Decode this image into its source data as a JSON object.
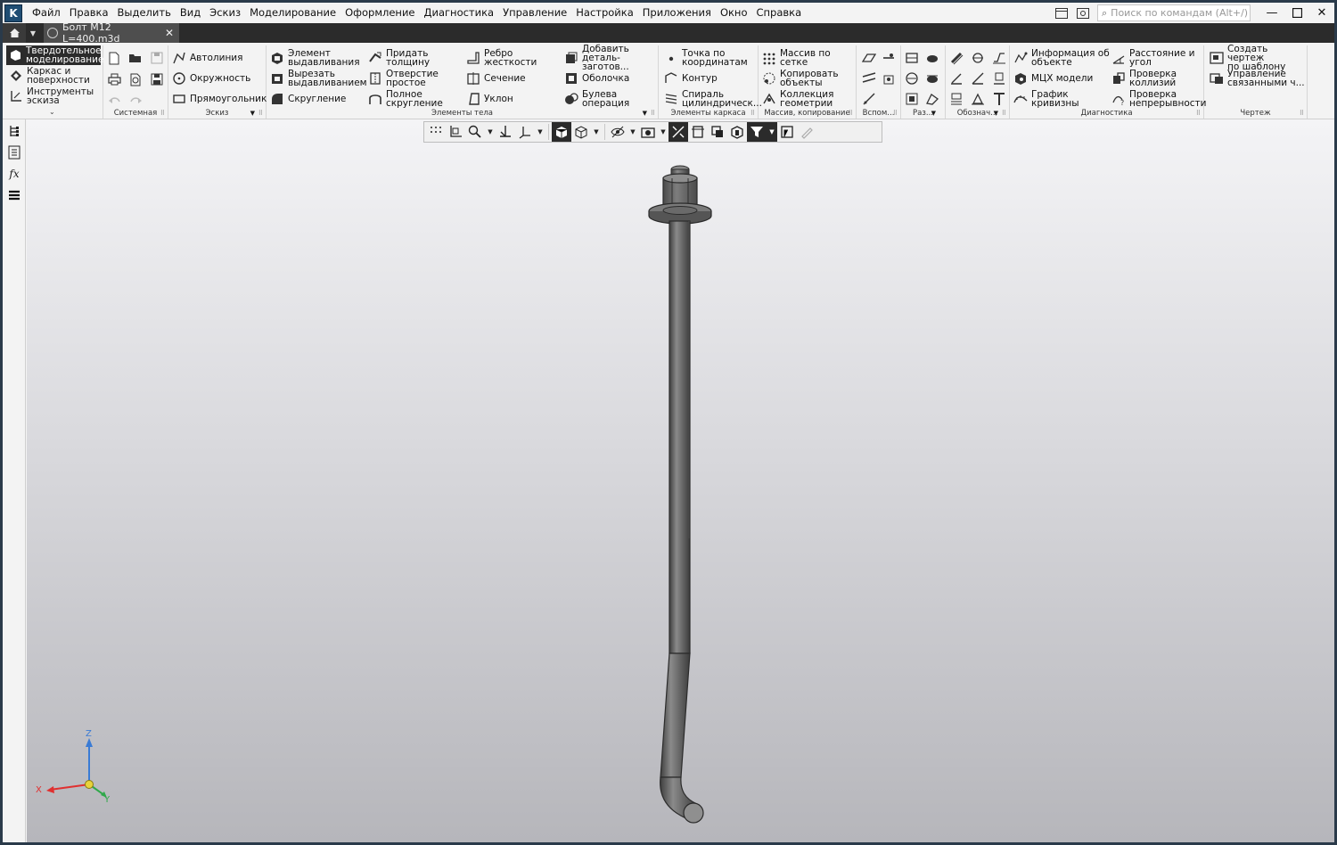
{
  "menubar": {
    "items": [
      "Файл",
      "Правка",
      "Выделить",
      "Вид",
      "Эскиз",
      "Моделирование",
      "Оформление",
      "Диагностика",
      "Управление",
      "Настройка",
      "Приложения",
      "Окно",
      "Справка"
    ],
    "search_placeholder": "Поиск по командам (Alt+/)"
  },
  "tabs": {
    "active_document": "Болт М12 L=400.m3d"
  },
  "ribbon": {
    "modes": [
      {
        "label": "Твердотельное\nмоделирование",
        "icon": "solid-modeling-icon",
        "active": true
      },
      {
        "label": "Каркас и\nповерхности",
        "icon": "wireframe-surfaces-icon",
        "active": false
      },
      {
        "label": "Инструменты\nэскиза",
        "icon": "sketch-tools-icon",
        "active": false
      }
    ],
    "groups": {
      "system": {
        "label": "Системная"
      },
      "sketch": {
        "label": "Эскиз",
        "buttons": [
          "Автолиния",
          "Окружность",
          "Прямоугольник"
        ]
      },
      "body_elements": {
        "label": "Элементы тела",
        "col1": [
          "Элемент\nвыдавливания",
          "Вырезать\nвыдавливанием",
          "Скругление"
        ],
        "col2": [
          "Придать\nтолщину",
          "Отверстие\nпростое",
          "Полное\nскругление"
        ],
        "col3": [
          "Ребро\nжесткости",
          "Сечение",
          "Уклон"
        ],
        "col4": [
          "Добавить\nдеталь-заготов...",
          "Оболочка",
          "Булева\nоперация"
        ]
      },
      "frame_elements": {
        "label": "Элементы каркаса",
        "buttons": [
          "Точка по\nкоординатам",
          "Контур",
          "Спираль\nцилиндрическ..."
        ]
      },
      "arrays": {
        "label": "Массив, копирование",
        "buttons": [
          "Массив по сетке",
          "Копировать\nобъекты",
          "Коллекция\nгеометрии"
        ]
      },
      "auxiliary": {
        "label": "Вспом..."
      },
      "sections": {
        "label": "Раз..."
      },
      "designations": {
        "label": "Обознач..."
      },
      "diagnostics": {
        "label": "Диагностика",
        "col1": [
          "Информация об\nобъекте",
          "МЦХ модели",
          "График\nкривизны"
        ],
        "col2": [
          "Расстояние и\nугол",
          "Проверка\nколлизий",
          "Проверка\nнепрерывности"
        ]
      },
      "drawing": {
        "label": "Чертеж",
        "buttons": [
          "Создать чертеж\nпо шаблону",
          "Управление\nсвязанными ч..."
        ]
      }
    }
  },
  "axes": {
    "x": "X",
    "y": "Y",
    "z": "Z"
  },
  "colors": {
    "accent_dark": "#2b2b2b",
    "model_gray": "#6a6a6a",
    "axis_x": "#e03030",
    "axis_y": "#2fa84a",
    "axis_z": "#3a7bd5",
    "origin": "#e8d23a"
  }
}
